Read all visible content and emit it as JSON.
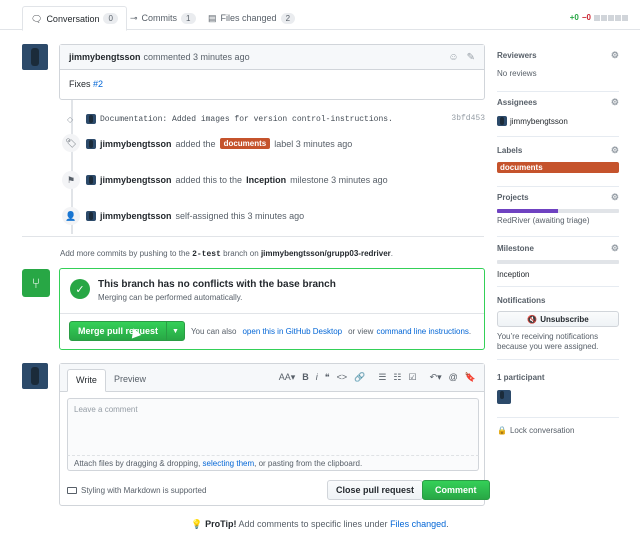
{
  "tabs": [
    {
      "label": "Conversation",
      "count": "0"
    },
    {
      "label": "Commits",
      "count": "1"
    },
    {
      "label": "Files changed",
      "count": "2"
    }
  ],
  "diffstat": {
    "added": "+0",
    "removed": "−0"
  },
  "comment": {
    "author": "jimmybengtsson",
    "action": "commented 3 minutes ago",
    "body_prefix": "Fixes",
    "issue_link": "#2"
  },
  "events": {
    "commit": {
      "message": "Documentation: Added images for version control-instructions.",
      "sha": "3bfd453"
    },
    "label": {
      "user": "jimmybengtsson",
      "text1": "added the",
      "label": "documents",
      "text2": "label 3 minutes ago"
    },
    "milestone": {
      "user": "jimmybengtsson",
      "text1": "added this to the",
      "milestone": "Inception",
      "text2": "milestone 3 minutes ago"
    },
    "assign": {
      "user": "jimmybengtsson",
      "text": "self-assigned this 3 minutes ago"
    }
  },
  "push_hint": {
    "prefix": "Add more commits by pushing to the",
    "branch": "2-test",
    "middle": "branch on",
    "repo": "jimmybengtsson/grupp03-redriver",
    "suffix": "."
  },
  "merge": {
    "title": "This branch has no conflicts with the base branch",
    "subtitle": "Merging can be performed automatically.",
    "button": "Merge pull request",
    "hint_prefix": "You can also",
    "desktop_link": "open this in GitHub Desktop",
    "hint_mid": "or view",
    "cli_link": "command line instructions",
    "hint_suffix": "."
  },
  "form": {
    "tab_write": "Write",
    "tab_preview": "Preview",
    "placeholder": "Leave a comment",
    "attach_prefix": "Attach files by dragging & dropping,",
    "attach_link": "selecting them",
    "attach_suffix": ", or pasting from the clipboard.",
    "markdown_hint": "Styling with Markdown is supported",
    "close_button": "Close pull request",
    "comment_button": "Comment",
    "toolbar": [
      "AA▾",
      "B",
      "i",
      "❝",
      "<>",
      "🔗",
      "☰",
      "☷",
      "☑",
      "↶▾",
      "@",
      "🔖"
    ]
  },
  "protip": {
    "label": "ProTip!",
    "text": "Add comments to specific lines under",
    "link": "Files changed",
    "suffix": "."
  },
  "sidebar": {
    "reviewers": {
      "title": "Reviewers",
      "value": "No reviews"
    },
    "assignees": {
      "title": "Assignees",
      "value": "jimmybengtsson"
    },
    "labels": {
      "title": "Labels",
      "value": "documents"
    },
    "projects": {
      "title": "Projects",
      "value": "RedRiver (awaiting triage)",
      "progress": 0.5
    },
    "milestone": {
      "title": "Milestone",
      "value": "Inception"
    },
    "notifications": {
      "title": "Notifications",
      "button": "Unsubscribe",
      "note": "You’re receiving notifications because you were assigned."
    },
    "participants": {
      "title": "1 participant"
    },
    "lock": "Lock conversation"
  },
  "colors": {
    "label": "#c5532c",
    "green": "#28a745",
    "link": "#0366d6",
    "project": "#6f42c1"
  }
}
